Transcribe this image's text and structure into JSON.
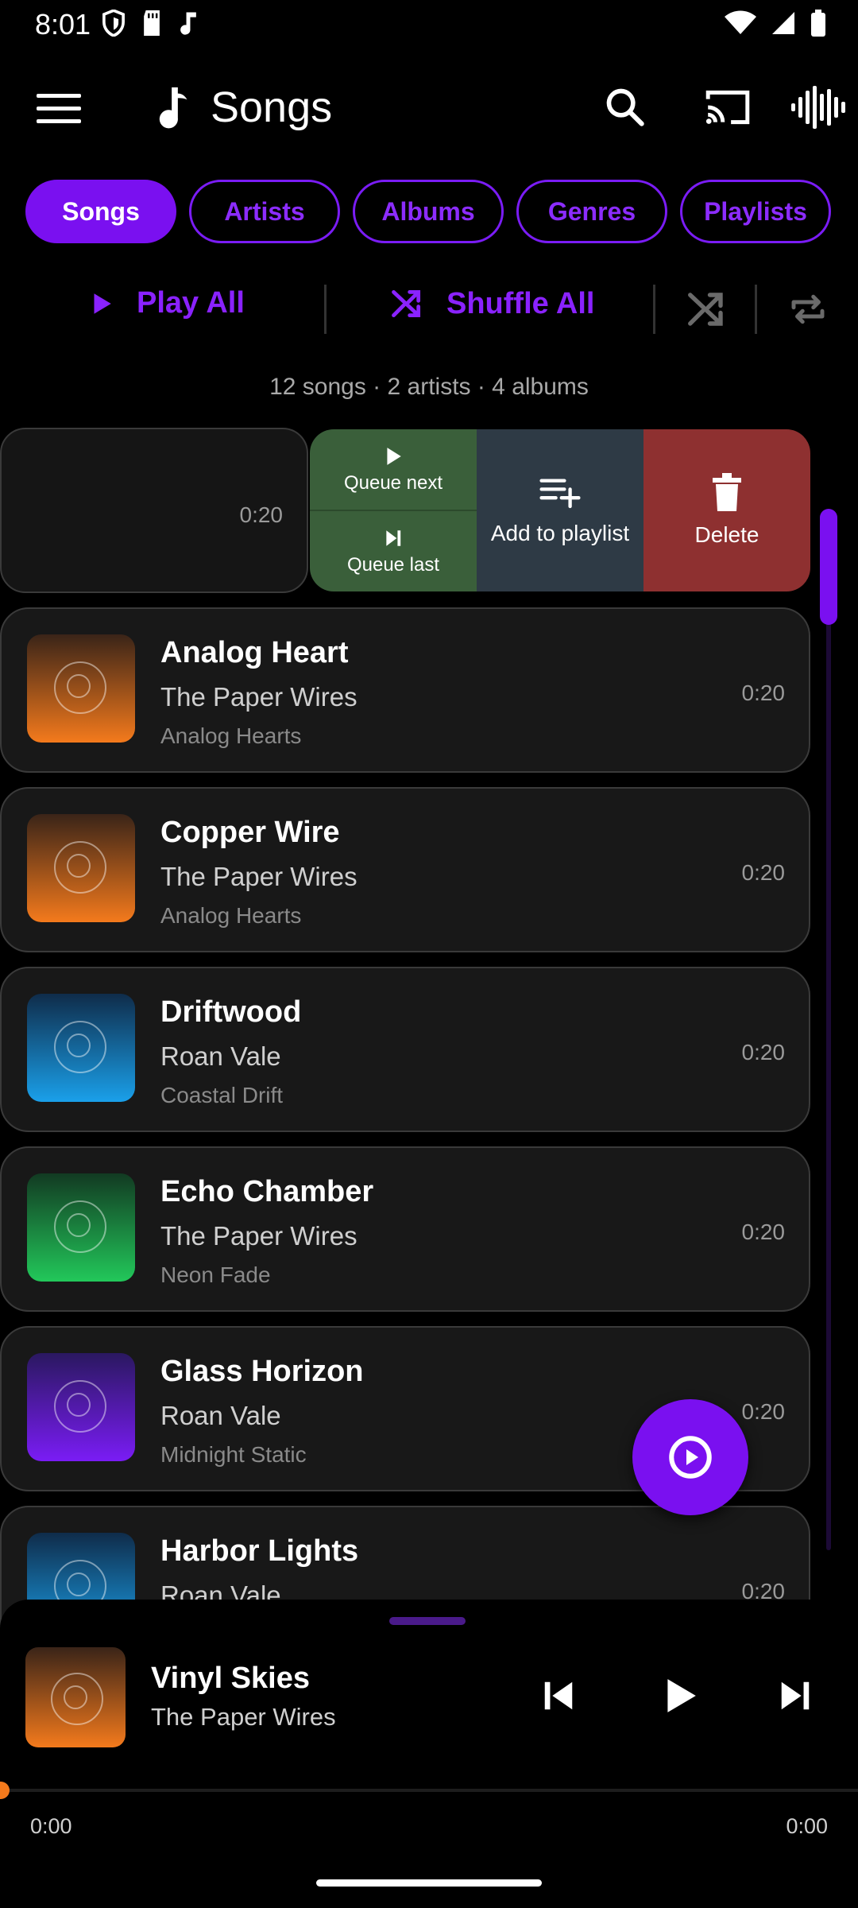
{
  "status_bar": {
    "time": "8:01"
  },
  "app_bar": {
    "title": "Songs"
  },
  "tabs": [
    {
      "label": "Songs",
      "active": true
    },
    {
      "label": "Artists",
      "active": false
    },
    {
      "label": "Albums",
      "active": false
    },
    {
      "label": "Genres",
      "active": false
    },
    {
      "label": "Playlists",
      "active": false
    }
  ],
  "actions": {
    "play_all": "Play All",
    "shuffle_all": "Shuffle All"
  },
  "summary": "12 songs · 2 artists · 4 albums",
  "swiped_row": {
    "duration": "0:20",
    "queue_next": "Queue next",
    "queue_last": "Queue last",
    "add_to_playlist": "Add to playlist",
    "delete": "Delete"
  },
  "songs": [
    {
      "title": "Analog Heart",
      "artist": "The Paper Wires",
      "album": "Analog Hearts",
      "duration": "0:20",
      "art_color": "orange"
    },
    {
      "title": "Copper Wire",
      "artist": "The Paper Wires",
      "album": "Analog Hearts",
      "duration": "0:20",
      "art_color": "orange"
    },
    {
      "title": "Driftwood",
      "artist": "Roan Vale",
      "album": "Coastal Drift",
      "duration": "0:20",
      "art_color": "blue"
    },
    {
      "title": "Echo Chamber",
      "artist": "The Paper Wires",
      "album": "Neon Fade",
      "duration": "0:20",
      "art_color": "green"
    },
    {
      "title": "Glass Horizon",
      "artist": "Roan Vale",
      "album": "Midnight Static",
      "duration": "0:20",
      "art_color": "purple"
    },
    {
      "title": "Harbor Lights",
      "artist": "Roan Vale",
      "album": "",
      "duration": "0:20",
      "art_color": "blue"
    }
  ],
  "now_playing": {
    "title": "Vinyl Skies",
    "artist": "The Paper Wires",
    "elapsed": "0:00",
    "total": "0:00",
    "progress": 0
  },
  "colors": {
    "accent": "#7a10f0",
    "accent_text": "#8c2cff",
    "delete": "#8e3030",
    "queue": "#3a5f3a",
    "add": "#2e3a45"
  }
}
